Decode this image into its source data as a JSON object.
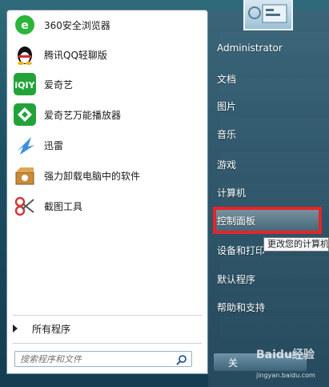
{
  "programs": [
    {
      "label": "360安全浏览器",
      "icon": "360-browser-icon"
    },
    {
      "label": "腾讯QQ轻聊版",
      "icon": "qq-penguin-icon"
    },
    {
      "label": "爱奇艺",
      "icon": "iqiyi-icon"
    },
    {
      "label": "爱奇艺万能播放器",
      "icon": "iqiyi-player-icon"
    },
    {
      "label": "迅雷",
      "icon": "xunlei-bird-icon"
    },
    {
      "label": "强力卸载电脑中的软件",
      "icon": "uninstall-box-icon"
    },
    {
      "label": "截图工具",
      "icon": "snipping-scissors-icon"
    }
  ],
  "all_programs_label": "所有程序",
  "search": {
    "placeholder": "搜索程序和文件"
  },
  "right_items": [
    {
      "label": "Administrator"
    },
    {
      "label": "文档"
    },
    {
      "label": "图片"
    },
    {
      "label": "音乐"
    },
    {
      "label": "游戏"
    },
    {
      "label": "计算机"
    },
    {
      "label": "控制面板"
    },
    {
      "label": "设备和打印"
    },
    {
      "label": "默认程序"
    },
    {
      "label": "帮助和支持"
    }
  ],
  "tooltip": "更改您的计算机",
  "shutdown_label": "关",
  "watermark": {
    "text": "Baidu经验",
    "sub": "jingyan.baidu.com"
  },
  "colors": {
    "highlight_border": "#e3252a",
    "accent_green": "#22a33a"
  }
}
